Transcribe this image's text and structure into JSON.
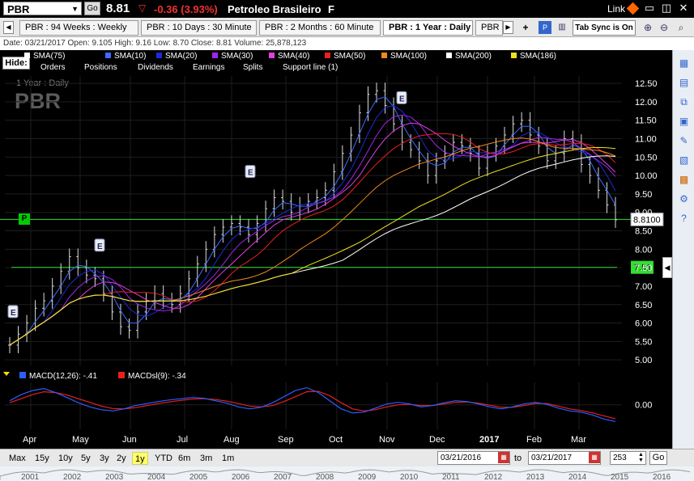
{
  "titlebar": {
    "symbol": "PBR",
    "go": "Go",
    "last": "8.81",
    "change": "-0.36 (3.93%)",
    "company": "Petroleo Brasileiro",
    "exchange": "F",
    "link": "Link"
  },
  "tabs": [
    {
      "label": "PBR : 94  Weeks : Weekly"
    },
    {
      "label": "PBR : 10 Days : 30 Minute"
    },
    {
      "label": "PBR : 2 Months : 60 Minute"
    },
    {
      "label": "PBR : 1 Year : Daily"
    },
    {
      "label": "PBR : 5"
    }
  ],
  "tab_sync": "Tab Sync is On",
  "info_bar": "Date: 03/21/2017   Open: 9.105   High: 9.16   Low: 8.70   Close: 8.81   Volume: 25,878,123",
  "legend": {
    "hide": "Hide:",
    "smas": [
      {
        "label": "SMA(75)",
        "color": "#ffffff"
      },
      {
        "label": "SMA(10)",
        "color": "#3b6cff"
      },
      {
        "label": "SMA(20)",
        "color": "#1c2bd8"
      },
      {
        "label": "SMA(30)",
        "color": "#a025f0"
      },
      {
        "label": "SMA(40)",
        "color": "#e040e0"
      },
      {
        "label": "SMA(50)",
        "color": "#e82020"
      },
      {
        "label": "SMA(100)",
        "color": "#f08a20"
      },
      {
        "label": "SMA(200)",
        "color": "#ffffff"
      },
      {
        "label": "SMA(186)",
        "color": "#f0e020"
      }
    ],
    "subitems": [
      "Orders",
      "Positions",
      "Dividends",
      "Earnings",
      "Splits",
      "Support line (1)"
    ]
  },
  "chart_data": {
    "type": "candlestick",
    "title": "1 Year : Daily",
    "watermark": "PBR",
    "ylim": [
      4.85,
      12.7
    ],
    "yticks": [
      "12.50",
      "12.00",
      "11.50",
      "11.00",
      "10.50",
      "10.00",
      "9.50",
      "9.00",
      "8.50",
      "8.00",
      "7.50",
      "7.00",
      "6.50",
      "6.00",
      "5.50",
      "5.00"
    ],
    "ytick_values": [
      12.5,
      12.0,
      11.5,
      11.0,
      10.5,
      10.0,
      9.5,
      9.0,
      8.5,
      8.0,
      7.5,
      7.0,
      6.5,
      6.0,
      5.5,
      5.0
    ],
    "x_months": [
      "Apr",
      "May",
      "Jun",
      "Jul",
      "Aug",
      "Sep",
      "Oct",
      "Nov",
      "Dec",
      "2017",
      "Feb",
      "Mar"
    ],
    "current_price": "8.8100",
    "current_value": 8.81,
    "support_label": "7.51",
    "support_value": 7.51,
    "marker_p": "P",
    "marker_p_value": 8.81,
    "earnings_markers": [
      "E",
      "E",
      "E",
      "E"
    ],
    "close_series": [
      5.4,
      5.7,
      6.0,
      6.4,
      6.6,
      7.0,
      7.4,
      7.8,
      7.5,
      7.3,
      7.2,
      6.8,
      6.3,
      5.9,
      5.8,
      6.3,
      6.6,
      6.8,
      6.6,
      6.5,
      6.8,
      7.2,
      7.6,
      8.0,
      8.4,
      8.6,
      8.7,
      8.6,
      8.4,
      8.7,
      9.1,
      9.4,
      9.3,
      9.0,
      9.2,
      9.3,
      9.4,
      9.6,
      10.1,
      10.6,
      11.1,
      11.7,
      12.2,
      12.3,
      11.9,
      11.4,
      10.9,
      10.7,
      10.4,
      10.0,
      10.4,
      10.6,
      10.9,
      10.8,
      10.6,
      10.2,
      10.6,
      10.8,
      11.1,
      11.4,
      11.5,
      11.1,
      10.8,
      10.4,
      10.6,
      11.0,
      10.9,
      10.3,
      10.0,
      9.6,
      9.2,
      8.8
    ],
    "macd": {
      "label_macd": "MACD(12,26): -.41",
      "label_signal": "MACDsl(9): -.34",
      "macd_color": "#2e5cff",
      "signal_color": "#e82020",
      "tick": "0.00",
      "tick_value": 0.0,
      "ylim": [
        -0.6,
        0.55
      ],
      "macd_series": [
        0.1,
        0.25,
        0.35,
        0.4,
        0.3,
        0.18,
        0.05,
        -0.05,
        -0.12,
        -0.15,
        -0.1,
        -0.02,
        0.03,
        0.08,
        0.12,
        0.15,
        0.18,
        0.16,
        0.1,
        0.04,
        -0.05,
        -0.1,
        -0.06,
        0.05,
        0.2,
        0.35,
        0.42,
        0.3,
        0.1,
        -0.1,
        -0.2,
        -0.18,
        -0.08,
        0.02,
        0.06,
        0.02,
        -0.05,
        -0.02,
        0.05,
        0.1,
        0.08,
        0.02,
        -0.05,
        -0.1,
        -0.05,
        0.02,
        0.06,
        0.01,
        -0.08,
        -0.15,
        -0.18,
        -0.25,
        -0.35,
        -0.41
      ],
      "signal_series": [
        0.05,
        0.15,
        0.25,
        0.32,
        0.3,
        0.24,
        0.15,
        0.06,
        -0.03,
        -0.09,
        -0.1,
        -0.07,
        -0.02,
        0.03,
        0.07,
        0.11,
        0.14,
        0.15,
        0.13,
        0.09,
        0.03,
        -0.03,
        -0.05,
        -0.02,
        0.08,
        0.2,
        0.32,
        0.33,
        0.22,
        0.05,
        -0.1,
        -0.15,
        -0.12,
        -0.05,
        0.0,
        0.01,
        -0.02,
        -0.02,
        0.02,
        0.06,
        0.07,
        0.04,
        -0.01,
        -0.06,
        -0.06,
        -0.02,
        0.03,
        0.03,
        -0.03,
        -0.1,
        -0.14,
        -0.2,
        -0.27,
        -0.34
      ]
    },
    "navigator_years": [
      "2001",
      "2002",
      "2003",
      "2004",
      "2005",
      "2006",
      "2007",
      "2008",
      "2009",
      "2010",
      "2011",
      "2012",
      "2013",
      "2014",
      "2015",
      "2016"
    ]
  },
  "bottom": {
    "periods": [
      "Max",
      "15y",
      "10y",
      "5y",
      "3y",
      "2y",
      "1y",
      "YTD",
      "6m",
      "3m",
      "1m"
    ],
    "active_period": "1y",
    "from_date": "03/21/2016",
    "to_label": "to",
    "to_date": "03/21/2017",
    "bars": "253",
    "go": "Go"
  }
}
